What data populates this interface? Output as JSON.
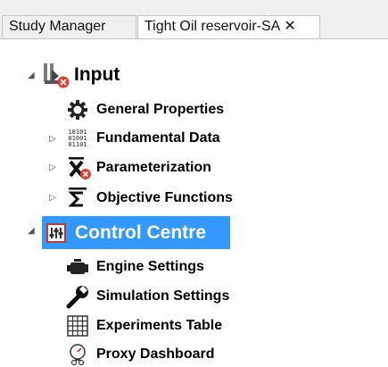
{
  "tabs": [
    {
      "label": "Study Manager"
    },
    {
      "label": "Tight Oil reservoir-SA",
      "close": "✕"
    }
  ],
  "tree": {
    "input": {
      "label": "Input",
      "children": [
        {
          "label": "General Properties",
          "icon": "gear-icon"
        },
        {
          "label": "Fundamental Data",
          "icon": "binary-data-icon",
          "collapsed": true,
          "binary": [
            "10101",
            "01001",
            "01101"
          ]
        },
        {
          "label": "Parameterization",
          "icon": "variable-x-icon",
          "collapsed": true
        },
        {
          "label": "Objective Functions",
          "icon": "sigma-icon",
          "collapsed": true
        }
      ]
    },
    "control": {
      "label": "Control Centre",
      "children": [
        {
          "label": "Engine Settings",
          "icon": "engine-icon"
        },
        {
          "label": "Simulation Settings",
          "icon": "wrench-icon"
        },
        {
          "label": "Experiments Table",
          "icon": "grid-table-icon"
        },
        {
          "label": "Proxy Dashboard",
          "icon": "dashboard-icon"
        }
      ]
    }
  },
  "colors": {
    "selection": "#3399ff",
    "error_badge": "#e03c31"
  }
}
